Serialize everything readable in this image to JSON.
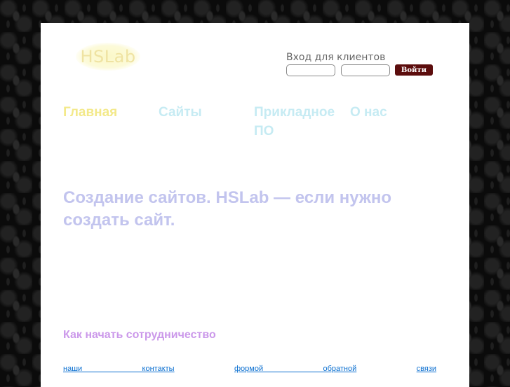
{
  "header": {
    "logo_text": "HSLab",
    "login": {
      "label": "Вход для клиентов",
      "login_placeholder": "",
      "password_placeholder": "",
      "submit_label": "Войти"
    }
  },
  "nav": {
    "items": [
      {
        "label": "Главная"
      },
      {
        "label": "Сайты"
      },
      {
        "label": "Прикладное ПО"
      },
      {
        "label": "О нас"
      }
    ]
  },
  "main": {
    "headline": "Создание сайтов. HSLab — если нужно создать сайт.",
    "subheading": "Как начать сотрудничество",
    "paragraph": {
      "link_contacts": "наши контакты",
      "link_feedback_part1": "формой обратной",
      "link_feedback_part2": "связи"
    }
  },
  "colors": {
    "background": "#0b0b0b",
    "page": "#ffffff",
    "nav_active": "#f3e98a",
    "nav_inactive": "#c6ebf3",
    "headline": "#c2c4ee",
    "subheading": "#cb98ea",
    "link": "#0a6fd0",
    "button": "#5c0d0d"
  }
}
